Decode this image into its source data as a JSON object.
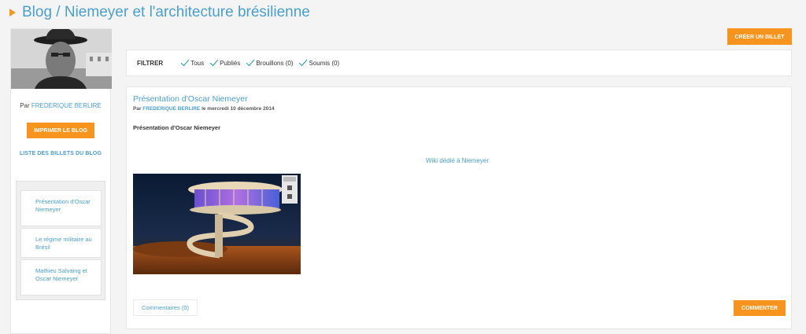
{
  "header": {
    "title": "Blog / Niemeyer et l'architecture brésilienne"
  },
  "sidebar": {
    "author_prefix": "Par",
    "author_name": "FREDERIQUE BERLIRE",
    "print_label": "IMPRIMER LE BLOG",
    "list_link": "LISTE DES BILLETS DU BLOG",
    "posts": [
      {
        "label": "Présentation d'Oscar Niemeyer"
      },
      {
        "label": "Le régime militaire au Brésil"
      },
      {
        "label": "Mathieu Salvaing et Oscar Niemeyer"
      }
    ]
  },
  "toolbar": {
    "create_label": "CRÉER UN BILLET"
  },
  "filter": {
    "label": "FILTRER",
    "options": [
      {
        "label": "Tous"
      },
      {
        "label": "Publiés"
      },
      {
        "label": "Brouillons (0)"
      },
      {
        "label": "Soumis (0)"
      }
    ]
  },
  "post": {
    "title": "Présentation d'Oscar Niemeyer",
    "meta_prefix": "Par",
    "meta_author": "FREDERIQUE BERLIRE",
    "meta_date": "le mercredi 10 décembre 2014",
    "subtitle": "Présentation d'Oscar Niemeyer",
    "wiki_link": "Wiki dédié à Niemeyer",
    "comments_label": "Commentaires (0)",
    "comment_button": "COMMENTER"
  },
  "colors": {
    "accent": "#f7941e",
    "link": "#4a9fcf",
    "check": "#3aa89a"
  }
}
